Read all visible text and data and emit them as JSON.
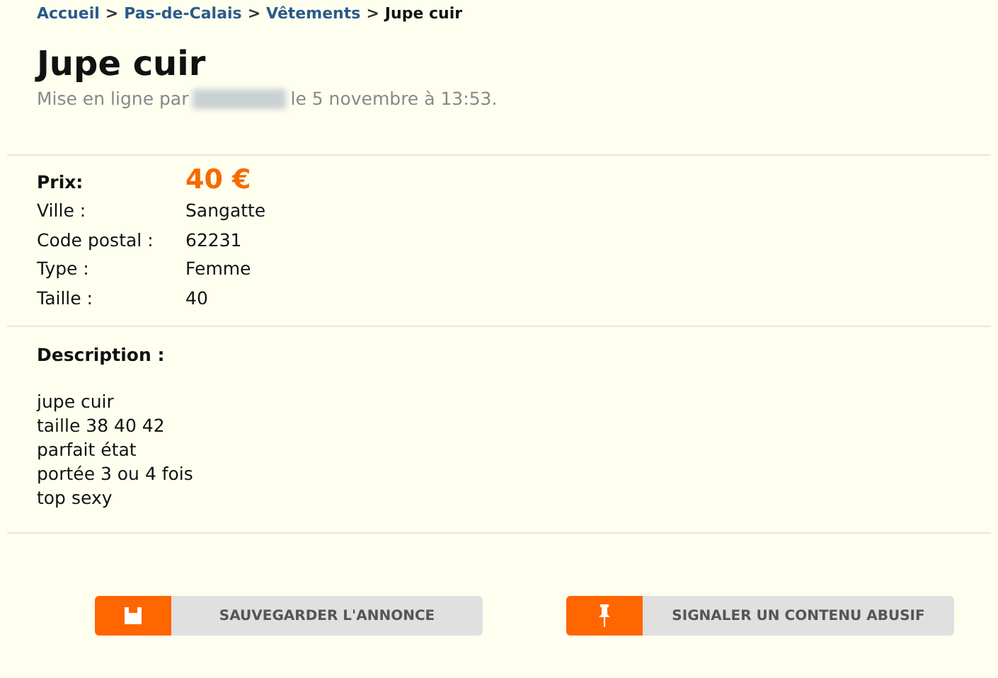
{
  "breadcrumb": [
    {
      "label": "Accueil",
      "kind": "link"
    },
    {
      "label": "Pas-de-Calais",
      "kind": "link"
    },
    {
      "label": "Vêtements",
      "kind": "link"
    },
    {
      "label": "Jupe cuir",
      "kind": "current"
    }
  ],
  "breadcrumb_separator": ">",
  "title": "Jupe cuir",
  "meta": {
    "prefix": "Mise en ligne par",
    "suffix": "le 5 novembre à 13:53."
  },
  "price": {
    "label": "Prix:",
    "value": "40 €"
  },
  "details": [
    {
      "label": "Ville :",
      "value": "Sangatte"
    },
    {
      "label": "Code postal :",
      "value": "62231"
    },
    {
      "label": "Type :",
      "value": "Femme"
    },
    {
      "label": "Taille :",
      "value": "40"
    }
  ],
  "description": {
    "label": "Description :",
    "lines": [
      "jupe cuir",
      "taille 38 40 42",
      "parfait état",
      "portée 3 ou 4 fois",
      "top sexy"
    ]
  },
  "buttons": [
    {
      "label": "SAUVEGARDER L'ANNONCE",
      "kind": "save"
    },
    {
      "label": "SIGNALER UN CONTENU ABUSIF",
      "kind": "report"
    }
  ]
}
